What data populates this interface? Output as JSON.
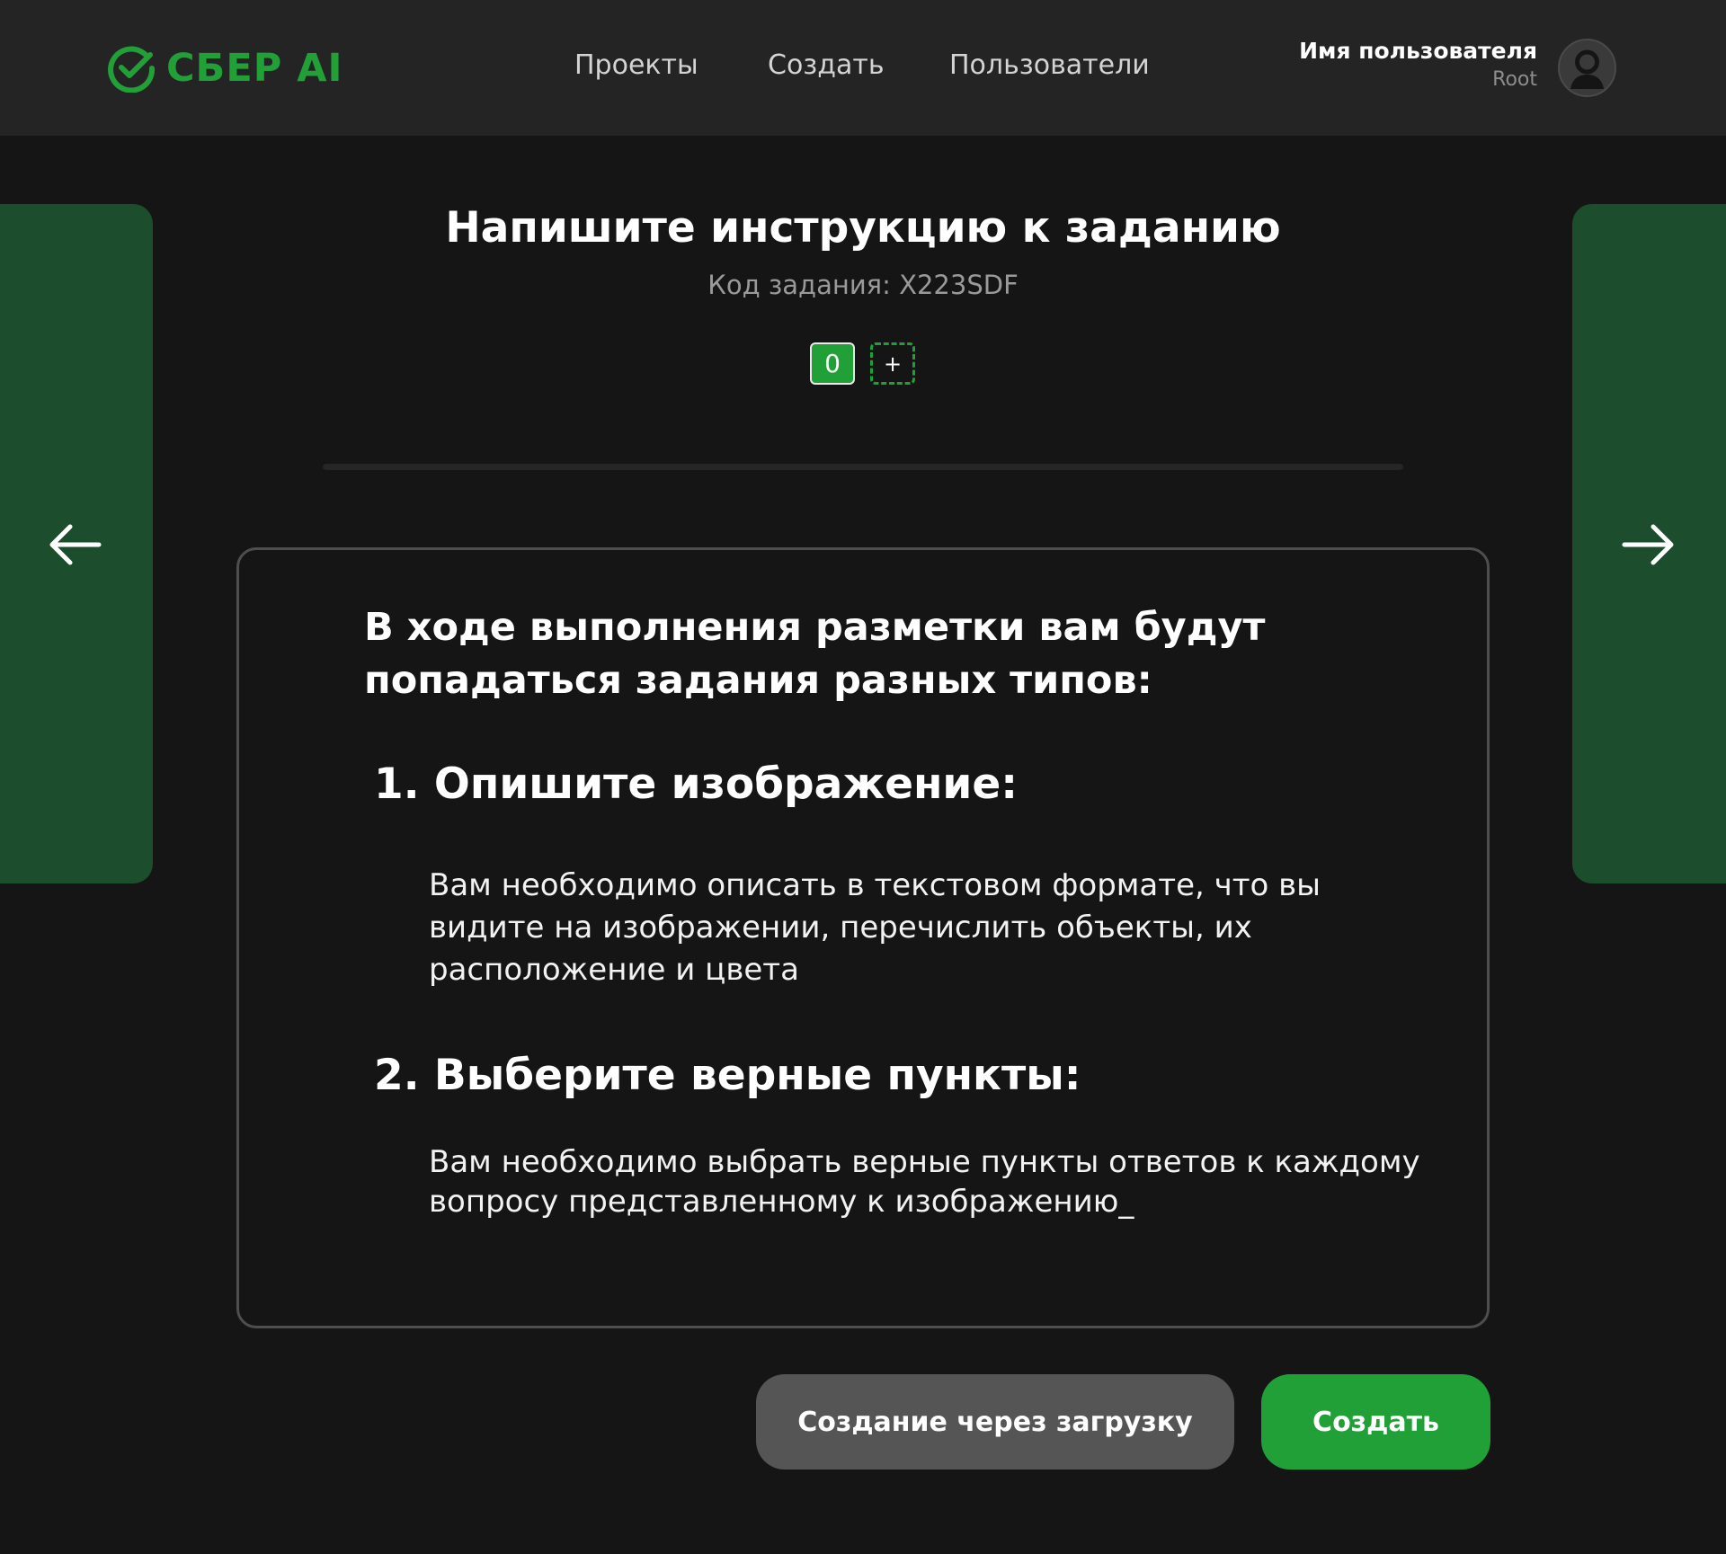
{
  "brand": {
    "name": "СБЕР AI",
    "color": "#21a038",
    "icon": "sber-check-icon"
  },
  "nav": {
    "items": [
      {
        "label": "Проекты"
      },
      {
        "label": "Создать"
      },
      {
        "label": "Пользователи"
      }
    ]
  },
  "user": {
    "name": "Имя пользователя",
    "role": "Root",
    "avatar_icon": "user-avatar-icon"
  },
  "page": {
    "title": "Напишите инструкцию к заданию",
    "task_code": "Код задания: X223SDF",
    "pages": [
      {
        "label": "0",
        "active": true
      }
    ],
    "add_page_label": "+",
    "prev_icon": "arrow-left-icon",
    "next_icon": "arrow-right-icon"
  },
  "instruction": {
    "intro": "В ходе выполнения разметки вам будут попадаться задания разных типов:",
    "items": [
      {
        "heading": "1. Опишите изображение:",
        "text": "Вам необходимо описать в текстовом формате, что вы видите на изображении, перечислить объекты, их расположение и цвета"
      },
      {
        "heading": "2. Выберите верные пункты:",
        "text": "Вам необходимо выбрать верные пункты ответов к каждому вопросу представленному к изображению_"
      }
    ]
  },
  "actions": {
    "upload_label": "Создание через загрузку",
    "create_label": "Создать"
  },
  "colors": {
    "accent": "#21a038",
    "header_bg": "#242424",
    "page_bg": "#151515",
    "side_panel": "#1c4d2d",
    "secondary_button": "#555555"
  }
}
